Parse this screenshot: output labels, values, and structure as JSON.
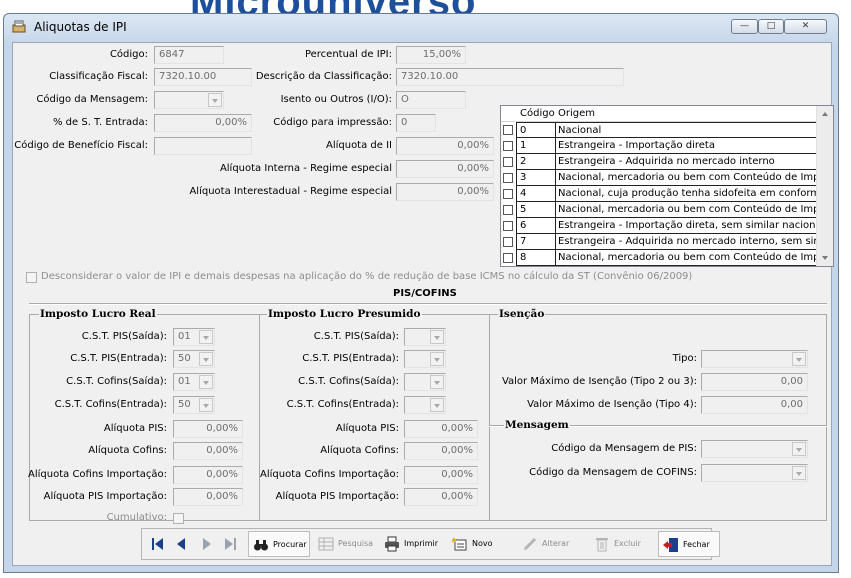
{
  "background_text": "Microuniverso",
  "window": {
    "title": "Aliquotas de IPI",
    "buttons": {
      "minimize": "—",
      "maximize": "□",
      "close": "✕"
    }
  },
  "form": {
    "codigo": {
      "label": "Código:",
      "value": "6847"
    },
    "classificacao": {
      "label": "Classificação Fiscal:",
      "value": "7320.10.00"
    },
    "codigo_mensagem": {
      "label": "Código da Mensagem:",
      "value": ""
    },
    "st_entrada": {
      "label": "% de S. T. Entrada:",
      "value": "0,00%"
    },
    "beneficio": {
      "label": "Código de Benefício Fiscal:",
      "value": ""
    },
    "percentual_ipi": {
      "label": "Percentual de IPI:",
      "value": "15,00%"
    },
    "descricao": {
      "label": "Descrição da Classificação:",
      "value": "7320.10.00"
    },
    "isento": {
      "label": "Isento ou Outros (I/O):",
      "value": "O"
    },
    "codigo_impressao": {
      "label": "Código para impressão:",
      "value": "0"
    },
    "aliquota_ii": {
      "label": "Alíquota de II",
      "value": "0,00%"
    },
    "aliquota_interna": {
      "label": "Alíquota Interna - Regime especial",
      "value": "0,00%"
    },
    "aliquota_interestadual": {
      "label": "Alíquota Interestadual - Regime especial",
      "value": "0,00%"
    }
  },
  "origem_grid": {
    "headers": [
      "Código",
      "Origem"
    ],
    "rows": [
      {
        "code": "0",
        "origem": "Nacional"
      },
      {
        "code": "1",
        "origem": "Estrangeira - Importação direta"
      },
      {
        "code": "2",
        "origem": "Estrangeira - Adquirida no mercado interno"
      },
      {
        "code": "3",
        "origem": "Nacional, mercadoria ou bem com Conteúdo de Impor"
      },
      {
        "code": "4",
        "origem": "Nacional, cuja produção tenha sidofeita em conformi"
      },
      {
        "code": "5",
        "origem": "Nacional, mercadoria ou bem com Conteúdo de Impor"
      },
      {
        "code": "6",
        "origem": "Estrangeira - Importação direta, sem similar nacional,"
      },
      {
        "code": "7",
        "origem": "Estrangeira - Adquirida no mercado interno, sem simil"
      },
      {
        "code": "8",
        "origem": "Nacional, mercadoria ou bem com Conteúdo de Impor"
      }
    ]
  },
  "desconsiderar": "Desconsiderar o valor de IPI e demais despesas na aplicação do % de redução de base ICMS no cálculo da ST (Convênio 06/2009)",
  "pis_cofins_title": "PIS/COFINS",
  "lucro_real": {
    "title": "Imposto Lucro Real",
    "cst_pis_saida": {
      "label": "C.S.T. PIS(Saída):",
      "value": "01"
    },
    "cst_pis_entrada": {
      "label": "C.S.T. PIS(Entrada):",
      "value": "50"
    },
    "cst_cofins_saida": {
      "label": "C.S.T. Cofins(Saída):",
      "value": "01"
    },
    "cst_cofins_entrada": {
      "label": "C.S.T. Cofins(Entrada):",
      "value": "50"
    },
    "aliq_pis": {
      "label": "Alíquota PIS:",
      "value": "0,00%"
    },
    "aliq_cofins": {
      "label": "Alíquota Cofins:",
      "value": "0,00%"
    },
    "aliq_cofins_imp": {
      "label": "Alíquota Cofins Importação:",
      "value": "0,00%"
    },
    "aliq_pis_imp": {
      "label": "Alíquota PIS Importação:",
      "value": "0,00%"
    },
    "cumulativo": "Cumulativo:"
  },
  "lucro_presumido": {
    "title": "Imposto Lucro Presumido",
    "cst_pis_saida": {
      "label": "C.S.T. PIS(Saída):",
      "value": ""
    },
    "cst_pis_entrada": {
      "label": "C.S.T. PIS(Entrada):",
      "value": ""
    },
    "cst_cofins_saida": {
      "label": "C.S.T. Cofins(Saída):",
      "value": ""
    },
    "cst_cofins_entrada": {
      "label": "C.S.T. Cofins(Entrada):",
      "value": ""
    },
    "aliq_pis": {
      "label": "Alíquota PIS:",
      "value": "0,00%"
    },
    "aliq_cofins": {
      "label": "Alíquota Cofins:",
      "value": "0,00%"
    },
    "aliq_cofins_imp": {
      "label": "Alíquota Cofins Importação:",
      "value": "0,00%"
    },
    "aliq_pis_imp": {
      "label": "Alíquota PIS Importação:",
      "value": "0,00%"
    }
  },
  "isencao": {
    "title": "Isenção",
    "tipo": {
      "label": "Tipo:",
      "value": ""
    },
    "valor_max_2ou3": {
      "label": "Valor Máximo de Isenção (Tipo 2 ou 3):",
      "value": "0,00"
    },
    "valor_max_4": {
      "label": "Valor Máximo de Isenção (Tipo 4):",
      "value": "0,00"
    }
  },
  "mensagem": {
    "title": "Mensagem",
    "pis": {
      "label": "Código da Mensagem de PIS:",
      "value": ""
    },
    "cofins": {
      "label": "Código da Mensagem de COFINS:",
      "value": ""
    }
  },
  "toolbar": {
    "procurar": "Procurar",
    "pesquisa": "Pesquisa",
    "imprimir": "Imprimir",
    "novo": "Novo",
    "alterar": "Alterar",
    "excluir": "Excluir",
    "fechar": "Fechar"
  },
  "colors": {
    "accent": "#1d4f9a",
    "window_frame": "#c6d6ea",
    "client": "#f0f0f0"
  }
}
